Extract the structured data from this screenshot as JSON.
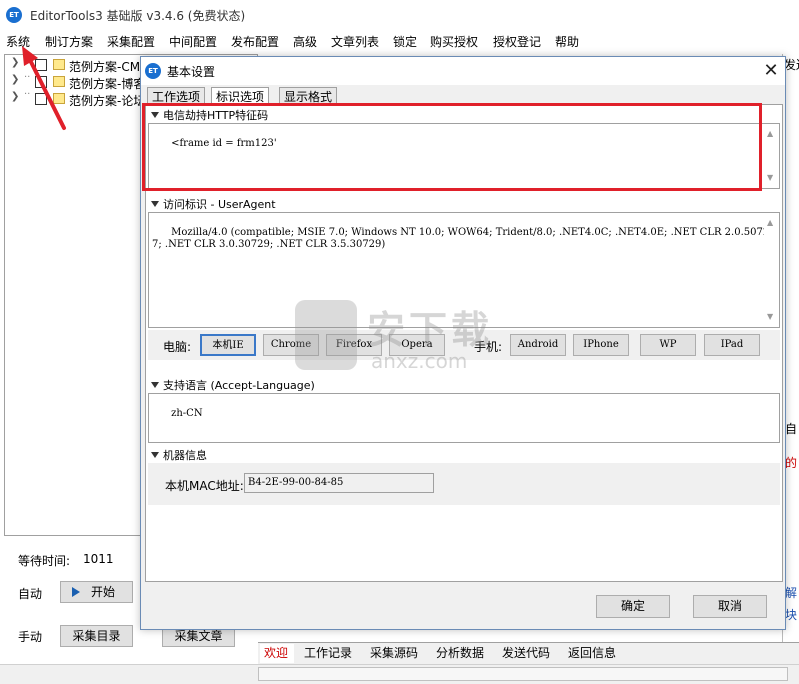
{
  "app": {
    "title": "EditorTools3 基础版 v3.4.6 (免费状态)",
    "icon_text": "ET"
  },
  "menu": [
    "系统",
    "制订方案",
    "采集配置",
    "中间配置",
    "发布配置",
    "高级",
    "文章列表",
    "锁定",
    "购买授权",
    "授权登记",
    "帮助"
  ],
  "tree": {
    "items": [
      {
        "label": "范例方案-CMS"
      },
      {
        "label": "范例方案-博客"
      },
      {
        "label": "范例方案-论坛"
      }
    ]
  },
  "left_controls": {
    "wait_label": "等待时间:",
    "wait_value": "1011",
    "auto_label": "自动",
    "start_button": "开始",
    "manual_label": "手动",
    "collect_dir_button": "采集目录",
    "collect_article_button": "采集文章"
  },
  "bottom_tabs": [
    "欢迎",
    "工作记录",
    "采集源码",
    "分析数据",
    "发送代码",
    "返回信息"
  ],
  "right_side": {
    "fragments": [
      "发送",
      "自",
      "的",
      "解",
      "块"
    ]
  },
  "watermark": {
    "text": "安下载",
    "sub": "anxz.com"
  },
  "dialog": {
    "icon_text": "ET",
    "title": "基本设置",
    "close": "✕",
    "tabs": [
      "工作选项",
      "标识选项",
      "显示格式"
    ],
    "sections": {
      "hijack": {
        "title": "电信劫持HTTP特征码",
        "value": "<frame id = frm123'"
      },
      "useragent": {
        "title": "访问标识 - UserAgent",
        "value": "Mozilla/4.0 (compatible; MSIE 7.0; Windows NT 10.0; WOW64; Trident/8.0; .NET4.0C; .NET4.0E; .NET CLR 2.0.50727; .NET CLR 3.0.30729; .NET CLR 3.5.30729)"
      },
      "language": {
        "title": "支持语言 (Accept-Language)",
        "value": "zh-CN"
      },
      "machine": {
        "title": "机器信息",
        "mac_label": "本机MAC地址:",
        "mac_value": "B4-2E-99-00-84-85"
      }
    },
    "ua_bar": {
      "pc_label": "电脑:",
      "pc_buttons": [
        "本机IE",
        "Chrome",
        "Firefox",
        "Opera"
      ],
      "mobile_label": "手机:",
      "mobile_buttons": [
        "Android",
        "IPhone",
        "WP",
        "IPad"
      ]
    },
    "ok_button": "确定",
    "cancel_button": "取消"
  },
  "colors": {
    "highlight": "#e0202a",
    "accent": "#1a6fd0"
  }
}
